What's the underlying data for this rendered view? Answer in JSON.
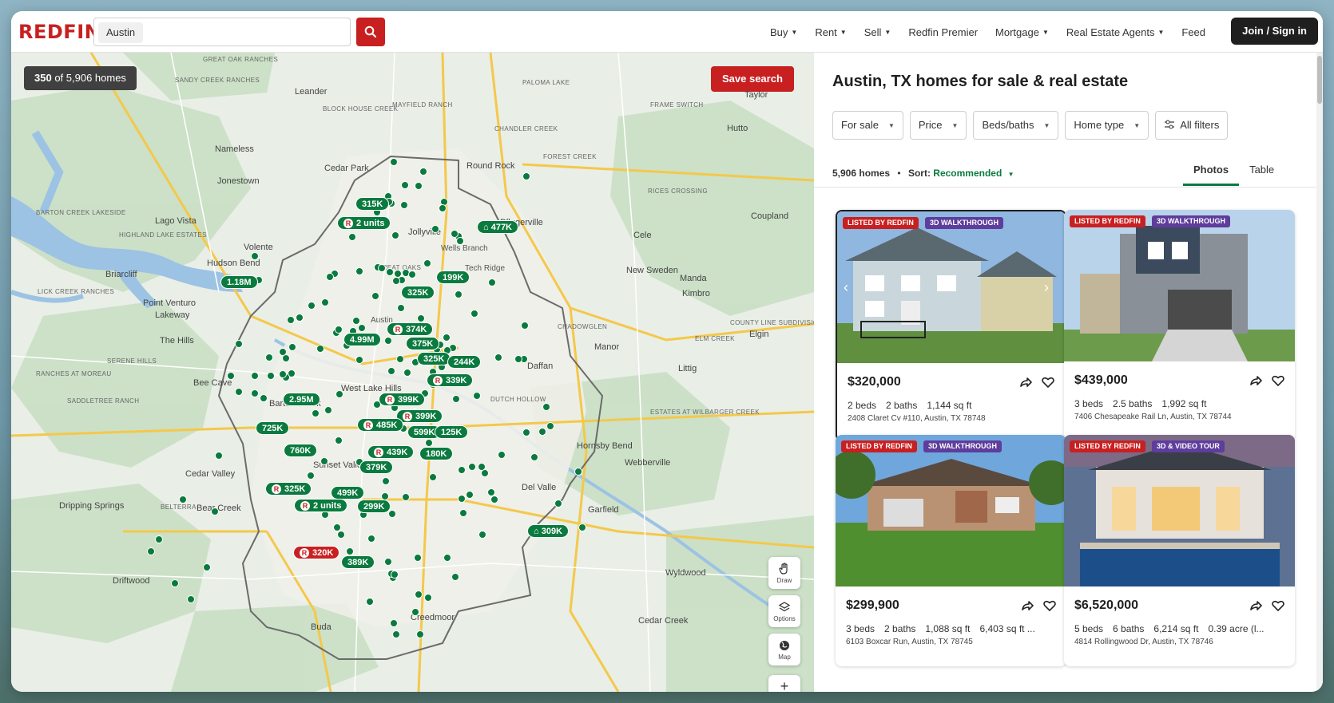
{
  "header": {
    "logo": "REDFIN",
    "search_value": "Austin",
    "nav": [
      "Buy",
      "Rent",
      "Sell",
      "Redfin Premier",
      "Mortgage",
      "Real Estate Agents",
      "Feed"
    ],
    "join_label": "Join / Sign in"
  },
  "map": {
    "count_strong": "350",
    "count_rest": " of 5,906 homes",
    "save_search": "Save search",
    "places": [
      "Leander",
      "Nameless",
      "Jonestown",
      "Cedar Park",
      "Round Rock",
      "Pflugerville",
      "Jollyville",
      "Lago Vista",
      "Volente",
      "Hudson Bend",
      "Briarcliff",
      "Point Venturo",
      "Lakeway",
      "The Hills",
      "Bee Cave",
      "Barton Creek",
      "West Lake Hills",
      "Sunset Valley",
      "Cedar Valley",
      "Dripping Springs",
      "Bear Creek",
      "Driftwood",
      "Buda",
      "Creedmoor",
      "Manor",
      "Daffan",
      "Littig",
      "Elgin",
      "Cele",
      "Manda",
      "Kimbro",
      "Coupland",
      "Taylor",
      "Hutto",
      "New Sweden",
      "Webberville",
      "Hornsby Bend",
      "Del Valle",
      "Garfield",
      "Wyldwood",
      "Cedar Creek",
      "Austin",
      "Wells Branch",
      "Tech Ridge",
      "Great Oaks",
      "Mayfield Ranch",
      "Paloma Lake",
      "Chandler Creek",
      "Forest Creek",
      "Frame Switch",
      "Block House Creek",
      "Sandy Creek Ranches",
      "Great Oak Ranches",
      "Barton Creek Lakeside",
      "Highland Lake Estates",
      "Lick Creek Ranches",
      "Serene Hills",
      "Ranches at Moreau",
      "Saddletree Ranch",
      "Belterra",
      "Chadowglen",
      "Elm Creek",
      "Rices Crossing",
      "County Line Subdivision",
      "Estates at Wilbarger Creek",
      "Dutch Hollow"
    ],
    "prices": [
      "315K",
      "2 units",
      "477K",
      "199K",
      "325K",
      "1.18M",
      "374K",
      "375K",
      "4.99M",
      "325K",
      "244K",
      "339K",
      "2.95M",
      "399K",
      "399K",
      "725K",
      "485K",
      "599K",
      "125K",
      "760K",
      "439K",
      "180K",
      "325K",
      "499K",
      "2 units",
      "299K",
      "309K",
      "320K",
      "389K",
      "379K"
    ],
    "tools": [
      "Draw",
      "Options",
      "Map"
    ]
  },
  "panel": {
    "title": "Austin, TX homes for sale & real estate",
    "filters": [
      "For sale",
      "Price",
      "Beds/baths",
      "Home type",
      "All filters"
    ],
    "home_count": "5,906 homes",
    "sort_label": "Sort:",
    "sort_value": "Recommended",
    "tabs": [
      "Photos",
      "Table"
    ]
  },
  "cards": [
    {
      "badge1": "LISTED BY REDFIN",
      "badge2": "3D WALKTHROUGH",
      "price": "$320,000",
      "beds": "2 beds",
      "baths": "2 baths",
      "sqft": "1,144 sq ft",
      "extra": "",
      "address": "2408 Claret Cv #110, Austin, TX 78748"
    },
    {
      "badge1": "LISTED BY REDFIN",
      "badge2": "3D WALKTHROUGH",
      "price": "$439,000",
      "beds": "3 beds",
      "baths": "2.5 baths",
      "sqft": "1,992 sq ft",
      "extra": "",
      "address": "7406 Chesapeake Rail Ln, Austin, TX 78744"
    },
    {
      "badge1": "LISTED BY REDFIN",
      "badge2": "3D WALKTHROUGH",
      "price": "$299,900",
      "beds": "3 beds",
      "baths": "2 baths",
      "sqft": "1,088 sq ft",
      "extra": "6,403 sq ft ...",
      "address": "6103 Boxcar Run, Austin, TX 78745"
    },
    {
      "badge1": "LISTED BY REDFIN",
      "badge2": "3D & VIDEO TOUR",
      "price": "$6,520,000",
      "beds": "5 beds",
      "baths": "6 baths",
      "sqft": "6,214 sq ft",
      "extra": "0.39 acre (l...",
      "address": "4814 Rollingwood Dr, Austin, TX 78746"
    }
  ],
  "colors": {
    "brand_red": "#c82021",
    "map_green": "#0a7a3e",
    "badge_purple": "#5e3d9c"
  }
}
